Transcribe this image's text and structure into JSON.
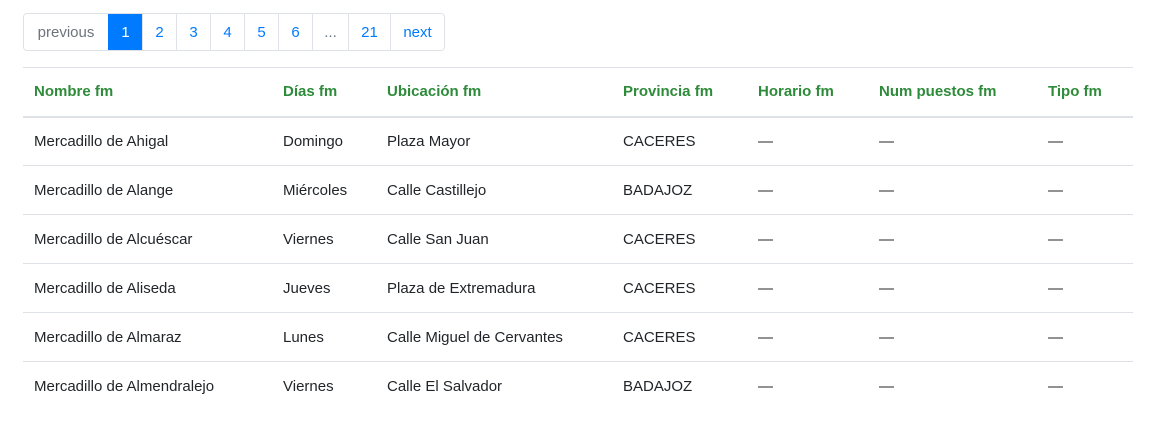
{
  "pagination": {
    "previous": "previous",
    "pages": [
      "1",
      "2",
      "3",
      "4",
      "5",
      "6"
    ],
    "active_page": "1",
    "ellipsis": "...",
    "last_page": "21",
    "next": "next"
  },
  "table": {
    "headers": [
      "Nombre fm",
      "Días fm",
      "Ubicación fm",
      "Provincia fm",
      "Horario fm",
      "Num puestos fm",
      "Tipo fm"
    ],
    "rows": [
      [
        "Mercadillo de Ahigal",
        "Domingo",
        "Plaza Mayor",
        "CACERES",
        "—",
        "—",
        "—"
      ],
      [
        "Mercadillo de Alange",
        "Miércoles",
        "Calle Castillejo",
        "BADAJOZ",
        "—",
        "—",
        "—"
      ],
      [
        "Mercadillo de Alcuéscar",
        "Viernes",
        "Calle San Juan",
        "CACERES",
        "—",
        "—",
        "—"
      ],
      [
        "Mercadillo de Aliseda",
        "Jueves",
        "Plaza de Extremadura",
        "CACERES",
        "—",
        "—",
        "—"
      ],
      [
        "Mercadillo de Almaraz",
        "Lunes",
        "Calle Miguel de Cervantes",
        "CACERES",
        "—",
        "—",
        "—"
      ],
      [
        "Mercadillo de Almendralejo",
        "Viernes",
        "Calle El Salvador",
        "BADAJOZ",
        "—",
        "—",
        "—"
      ]
    ]
  },
  "colors": {
    "header_text": "#2e8b3a",
    "link": "#007bff",
    "active_page_bg": "#007bff",
    "border": "#dee2e6"
  }
}
